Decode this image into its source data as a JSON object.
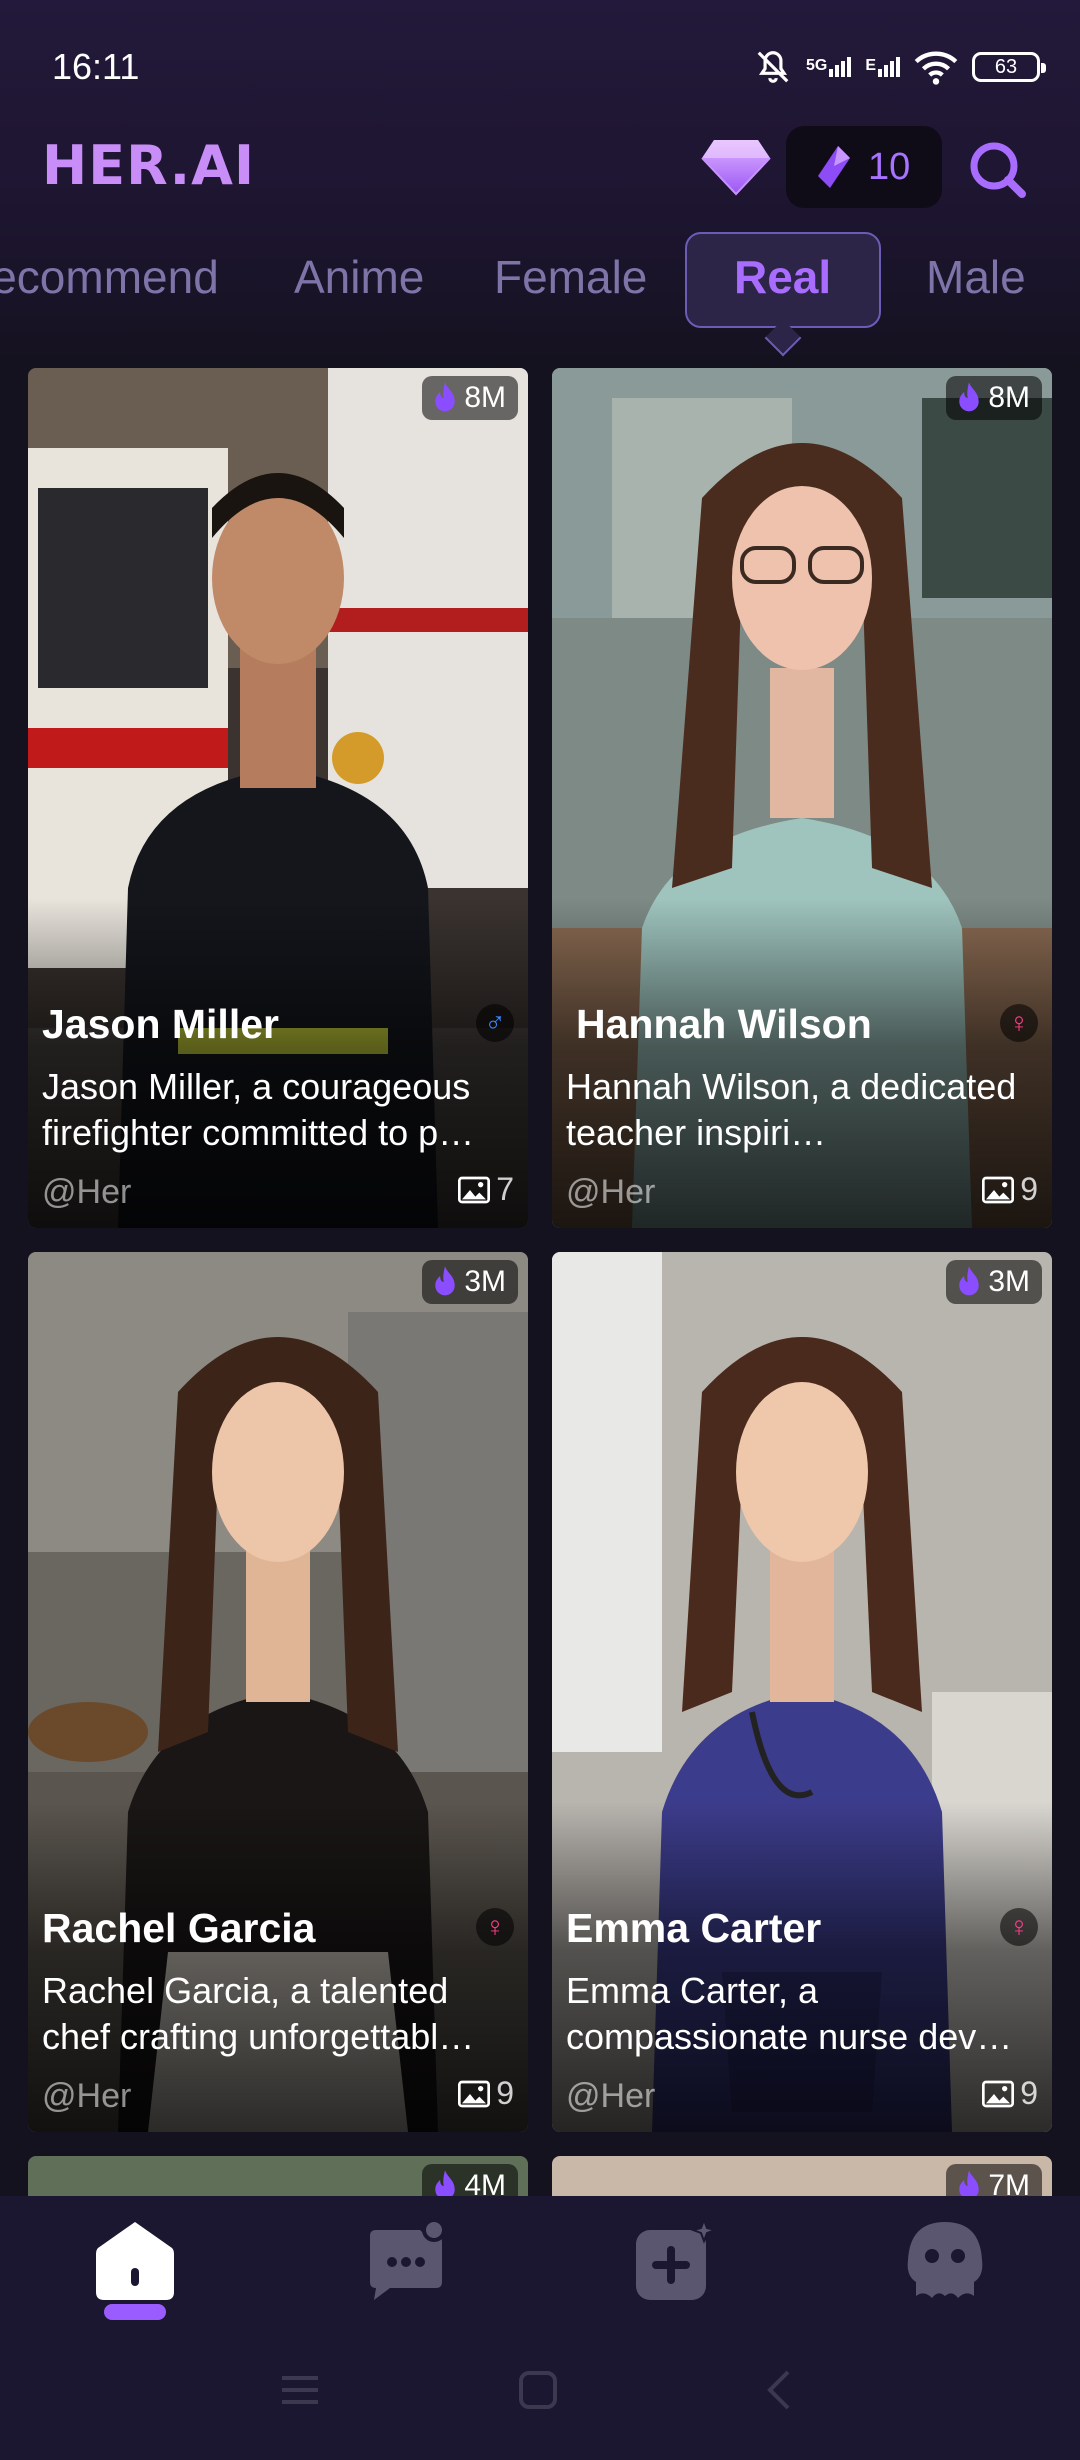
{
  "status_bar": {
    "time": "16:11",
    "network": "5G",
    "network2": "E",
    "battery": "63"
  },
  "header": {
    "logo": "HER.AI",
    "coins": "10"
  },
  "tabs": [
    {
      "label": "Recommend",
      "active": false
    },
    {
      "label": "Anime",
      "active": false
    },
    {
      "label": "Female",
      "active": false
    },
    {
      "label": "Real",
      "active": true
    },
    {
      "label": "Male",
      "active": false
    }
  ],
  "cards": [
    {
      "name": "Jason Miller",
      "gender": "male",
      "popularity": "8M",
      "description": "Jason Miller, a courageous firefighter committed to p…",
      "handle": "@Her",
      "photos": "7"
    },
    {
      "name": "Hannah Wilson",
      "gender": "female",
      "popularity": "8M",
      "description": "Hannah Wilson, a dedicated teacher inspiri…",
      "handle": "@Her",
      "photos": "9"
    },
    {
      "name": "Rachel Garcia",
      "gender": "female",
      "popularity": "3M",
      "description": "Rachel Garcia, a talented chef crafting unforgettabl…",
      "handle": "@Her",
      "photos": "9"
    },
    {
      "name": "Emma Carter",
      "gender": "female",
      "popularity": "3M",
      "description": "Emma Carter, a compassionate nurse dev…",
      "handle": "@Her",
      "photos": "9"
    },
    {
      "popularity": "4M"
    },
    {
      "popularity": "7M"
    }
  ],
  "bottom_nav": [
    {
      "icon": "home-icon",
      "active": true
    },
    {
      "icon": "chat-icon",
      "active": false
    },
    {
      "icon": "create-icon",
      "active": false
    },
    {
      "icon": "profile-icon",
      "active": false
    }
  ],
  "colors": {
    "accent": "#9a5cff",
    "background": "#151220",
    "logo": "#c88df7",
    "female": "#ff3d8a",
    "male": "#3d8bff"
  }
}
